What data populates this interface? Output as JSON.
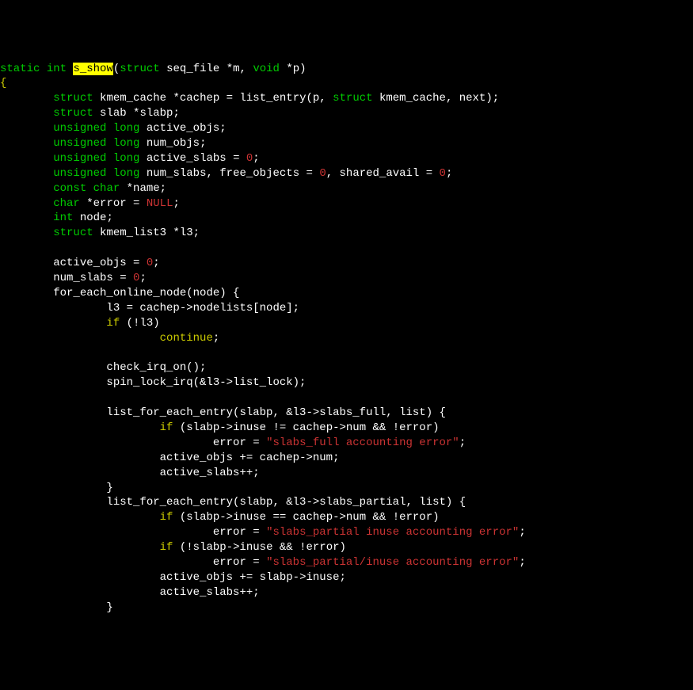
{
  "fn_name_highlight": "s_show",
  "params": {
    "p1_type": "struct",
    "p1": "seq_file *m",
    "p2_type": "void",
    "p2": "*p"
  },
  "decl": {
    "kmem_cache": "kmem_cache *cachep =",
    "list_entry": "list_entry(p,",
    "kmem_cache2": "kmem_cache, next);",
    "slab": "slab *slabp;",
    "active_objs": "active_objs;",
    "num_objs": "num_objs;",
    "active_slabs": "active_slabs =",
    "num_slabs": "num_slabs, free_objects =",
    "shared_avail": ", shared_avail =",
    "name": "*name;",
    "error": "*error =",
    "node": "node;",
    "l3": "kmem_list3 *l3;"
  },
  "zero": "0",
  "null": "NULL",
  "body": {
    "assign1": "active_objs =",
    "assign1_end": ";",
    "assign2": "num_slabs =",
    "assign2_end": ";",
    "foreach": "for_each_online_node(node) {",
    "l3_assign": "l3 = cachep->nodelists[node];",
    "if_l3": "(!l3)",
    "continue": "continue",
    "check_irq": "check_irq_on();",
    "spin_lock": "spin_lock_irq(&l3->list_lock);",
    "lfe1": "list_for_each_entry(slabp, &l3->slabs_full, list) {",
    "if1": "(slabp->inuse != cachep->num && !error)",
    "err1_asn": "error =",
    "err1_str": "\"slabs_full accounting error\"",
    "inc1": "active_objs += cachep->num;",
    "inc2": "active_slabs++;",
    "close1": "}",
    "lfe2": "list_for_each_entry(slabp, &l3->slabs_partial, list) {",
    "if2": "(slabp->inuse == cachep->num && !error)",
    "err2_asn": "error =",
    "err2_str": "\"slabs_partial inuse accounting error\"",
    "if3": "(!slabp->inuse && !error)",
    "err3_asn": "error =",
    "err3_str": "\"slabs_partial/inuse accounting error\"",
    "inc3": "active_objs += slabp->inuse;",
    "inc4": "active_slabs++;",
    "close2": "}"
  },
  "kw": {
    "static": "static",
    "int": "int",
    "struct": "struct",
    "unsigned": "unsigned",
    "long": "long",
    "const": "const",
    "char": "char",
    "void": "void",
    "if": "if"
  }
}
